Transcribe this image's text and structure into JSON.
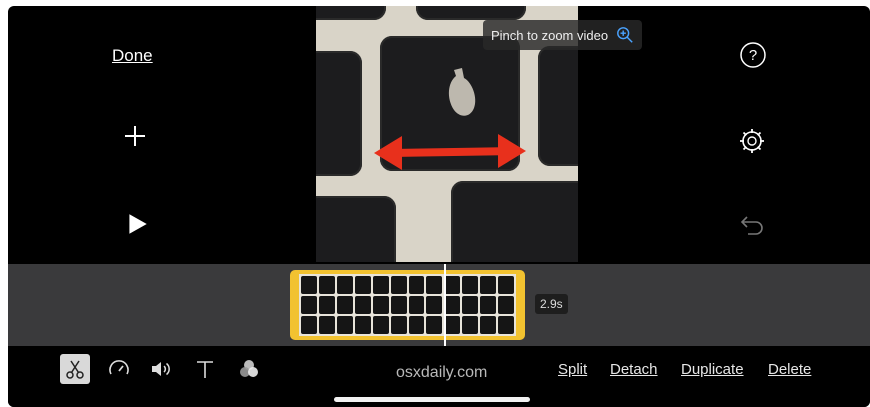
{
  "left_controls": {
    "done_label": "Done",
    "icons": [
      "plus-icon",
      "play-icon"
    ]
  },
  "viewer": {
    "pinch_hint": "Pinch to zoom video",
    "hint_icon": "zoom-in-icon",
    "accent": "#e8301c"
  },
  "right_controls": {
    "icons": [
      "help-icon",
      "settings-icon",
      "undo-icon"
    ]
  },
  "timeline": {
    "clip_duration": "2.9s",
    "clip_border_color": "#f2c230"
  },
  "toolbar": {
    "tools": [
      "scissors-icon",
      "speed-icon",
      "volume-icon",
      "text-icon",
      "filters-icon"
    ],
    "watermark": "osxdaily.com",
    "actions": {
      "split": "Split",
      "detach": "Detach",
      "duplicate": "Duplicate",
      "delete": "Delete"
    }
  }
}
